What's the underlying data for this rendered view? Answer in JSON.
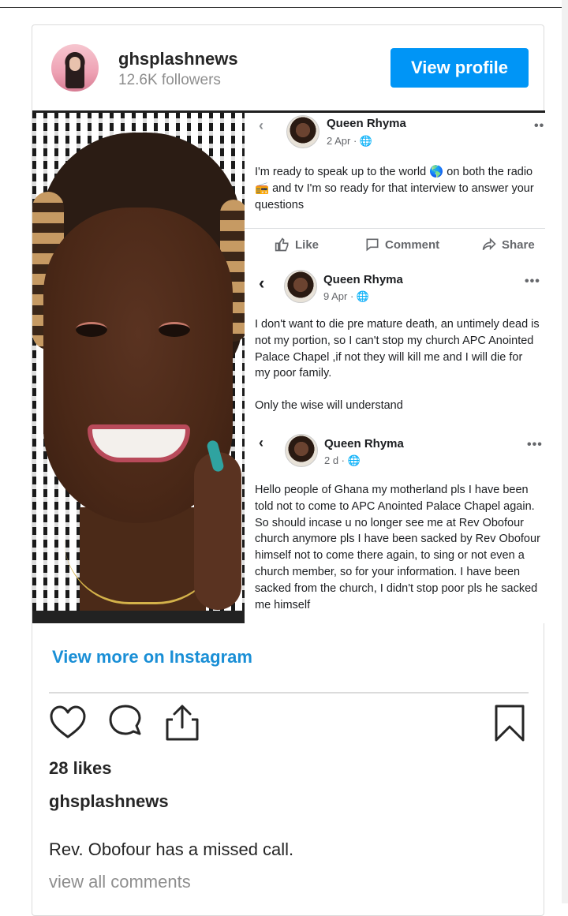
{
  "profile": {
    "username": "ghsplashnews",
    "followers": "12.6K followers",
    "view_profile_label": "View profile"
  },
  "screenshot_posts": [
    {
      "name": "Queen Rhyma",
      "date": "2 Apr · ",
      "text": "I'm ready to speak up to the world 🌎 on both the radio 📻 and tv I'm so ready for that interview to answer your questions",
      "actions": {
        "like": "Like",
        "comment": "Comment",
        "share": "Share"
      }
    },
    {
      "name": "Queen Rhyma",
      "date": "9 Apr · ",
      "text": "I don't want to die pre mature death, an untimely dead is not my portion, so I can't stop my church APC Anointed Palace Chapel ,if not they will kill me and I will die for my poor family.",
      "text2": "Only the wise will understand"
    },
    {
      "name": "Queen Rhyma",
      "date": "2 d · ",
      "text": "Hello people of Ghana my motherland pls I have been told not to come to APC Anointed Palace Chapel again. So should incase u no longer see me at Rev Obofour church anymore pls I have been sacked by Rev Obofour himself not to come there again, to sing or not even a church member, so for your information. I have been sacked from the church, I didn't stop poor pls he sacked me himself"
    }
  ],
  "view_more_label": "View more on Instagram",
  "likes": "28 likes",
  "caption": {
    "username": "ghsplashnews",
    "text": "Rev. Obofour has a missed call."
  },
  "view_comments_label": "view all comments",
  "colors": {
    "brand_blue": "#0095f6",
    "link_blue": "#1a8fd6",
    "muted": "#8e8e8e",
    "border": "#dbdbdb"
  },
  "icons": [
    "heart-icon",
    "comment-icon",
    "share-icon",
    "bookmark-icon",
    "globe-icon",
    "thumbs-up-icon",
    "speech-bubble-icon",
    "share-arrow-icon",
    "back-chevron-icon",
    "more-dots-icon"
  ]
}
